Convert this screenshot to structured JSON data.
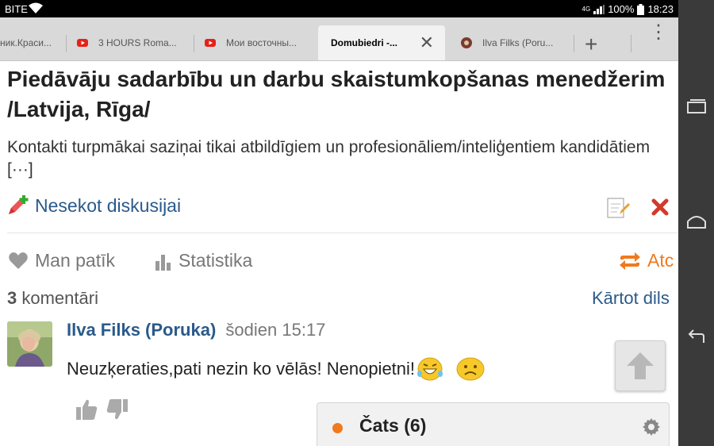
{
  "status_bar": {
    "carrier": "BITE",
    "network": "4G",
    "battery": "100%",
    "time": "18:23"
  },
  "tabs": [
    {
      "label": "ник.Краси...",
      "favicon": "none"
    },
    {
      "label": "3 HOURS Roma...",
      "favicon": "youtube-icon"
    },
    {
      "label": "Мои восточны...",
      "favicon": "youtube-icon"
    },
    {
      "label": "Domubiedri -...",
      "favicon": "none",
      "active": true
    },
    {
      "label": "Ilva Filks (Poru...",
      "favicon": "site-icon"
    }
  ],
  "post": {
    "title": "Piedāvāju sadarbību un darbu skaistumkopšanas menedžerim /Latvija, Rīga/",
    "excerpt": "Kontakti turpmākai saziņai tikai atbildīgiem un profesionāliem/inteliģentiem kandidātiem [···]",
    "unfollow_label": "Nesekot diskusijai"
  },
  "actions": {
    "like_label": "Man patīk",
    "stats_label": "Statistika",
    "share_label": "Atc"
  },
  "comments": {
    "count": "3",
    "count_label": "komentāri",
    "sort_label": "Kārtot dils"
  },
  "comment": {
    "author": "Ilva Filks (Poruka)",
    "time": "šodien 15:17",
    "text": "Neuzķeraties,pati nezin ko vēlās! Nenopietni!"
  },
  "chat": {
    "label": "Čats (6)"
  },
  "colors": {
    "link": "#2a5a8a",
    "accent": "#f07a1f",
    "delete": "#d23a2a"
  }
}
